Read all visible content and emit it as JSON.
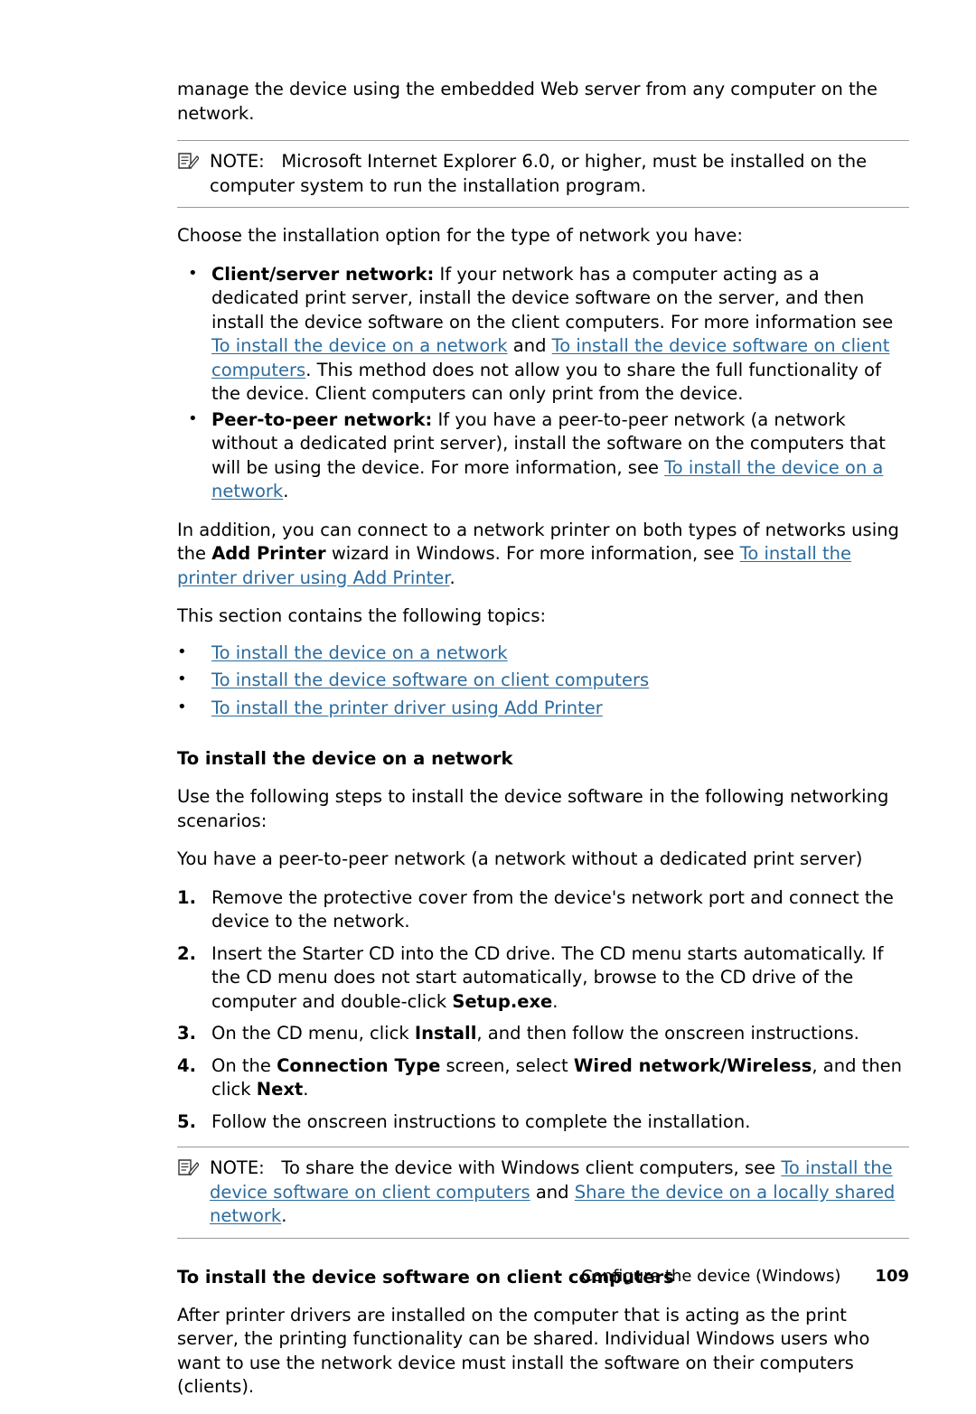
{
  "document": {
    "intro_paragraph": "manage the device using the embedded Web server from any computer on the network.",
    "note1": {
      "label": "NOTE:",
      "text": "Microsoft Internet Explorer 6.0, or higher, must be installed on the computer system to run the installation program."
    },
    "choose_paragraph": "Choose the installation option for the type of network you have:",
    "bullets": [
      {
        "title": "Client/server network:",
        "text_1": " If your network has a computer acting as a dedicated print server, install the device software on the server, and then install the device software on the client computers. For more information see ",
        "link_1": "To install the device on a network",
        "text_2": " and ",
        "link_2": "To install the device software on client computers",
        "text_3": ". This method does not allow you to share the full functionality of the device. Client computers can only print from the device."
      },
      {
        "title": "Peer-to-peer network:",
        "text_1": " If you have a peer-to-peer network (a network without a dedicated print server), install the software on the computers that will be using the device. For more information, see ",
        "link_1": "To install the device on a network",
        "text_2": "."
      }
    ],
    "addprinter": {
      "text_1": "In addition, you can connect to a network printer on both types of networks using the ",
      "bold_1": "Add Printer",
      "text_2": " wizard in Windows. For more information, see ",
      "link_1": "To install the printer driver using Add Printer",
      "text_3": "."
    },
    "topics_intro": "This section contains the following topics:",
    "topics": [
      "To install the device on a network",
      "To install the device software on client computers",
      "To install the printer driver using Add Printer"
    ],
    "section1": {
      "heading": "To install the device on a network",
      "para1": "Use the following steps to install the device software in the following networking scenarios:",
      "para2": "You have a peer-to-peer network (a network without a dedicated print server)",
      "steps": [
        {
          "num": "1.",
          "text_1": "Remove the protective cover from the device's network port and connect the device to the network."
        },
        {
          "num": "2.",
          "text_1": "Insert the Starter CD into the CD drive. The CD menu starts automatically. If the CD menu does not start automatically, browse to the CD drive of the computer and double-click ",
          "bold_1": "Setup.exe",
          "text_2": "."
        },
        {
          "num": "3.",
          "text_1": "On the CD menu, click ",
          "bold_1": "Install",
          "text_2": ", and then follow the onscreen instructions."
        },
        {
          "num": "4.",
          "text_1": "On the ",
          "bold_1": "Connection Type",
          "text_2": " screen, select ",
          "bold_2": "Wired network/Wireless",
          "text_3": ", and then click ",
          "bold_3": "Next",
          "text_4": "."
        },
        {
          "num": "5.",
          "text_1": "Follow the onscreen instructions to complete the installation."
        }
      ]
    },
    "note2": {
      "label": "NOTE:",
      "text_1": "To share the device with Windows client computers, see ",
      "link_1": "To install the device software on client computers",
      "text_2": " and ",
      "link_2": "Share the device on a locally shared network",
      "text_3": "."
    },
    "section2": {
      "heading": "To install the device software on client computers",
      "para1": "After printer drivers are installed on the computer that is acting as the print server, the printing functionality can be shared. Individual Windows users who want to use the network device must install the software on their computers (clients)."
    },
    "footer": {
      "text": "Configure the device (Windows)",
      "page": "109"
    },
    "colors": {
      "link": "#2b6b9e",
      "rule": "#9a9a9a",
      "text": "#000000"
    }
  }
}
